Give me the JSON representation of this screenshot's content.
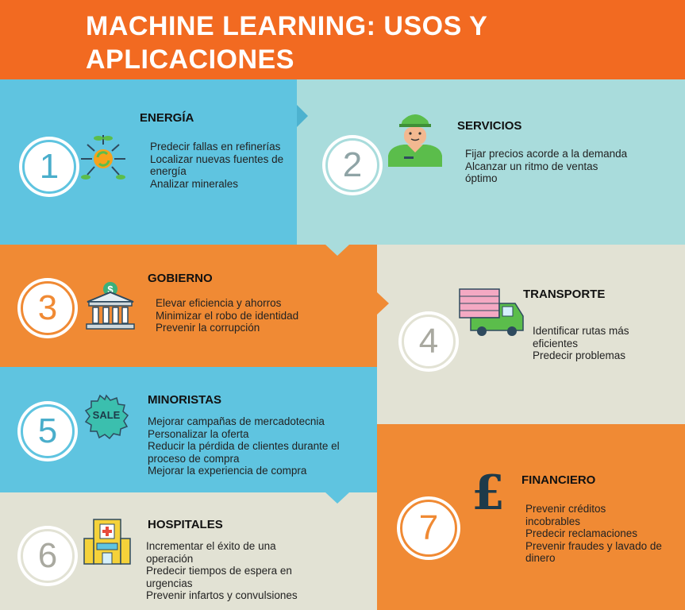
{
  "title": "MACHINE LEARNING: USOS Y APLICACIONES",
  "colors": {
    "orange": "#f26a21",
    "light_orange": "#f08a34",
    "blue": "#5fc4e0",
    "teal": "#a9dcdc",
    "beige": "#e2e2d4"
  },
  "sections": [
    {
      "number": "1",
      "heading": "ENERGÍA",
      "icon": "energy-sprout-icon",
      "items": [
        "Predecir fallas en refinerías",
        "Localizar nuevas fuentes de energía",
        "Analizar minerales"
      ]
    },
    {
      "number": "2",
      "heading": "SERVICIOS",
      "icon": "service-worker-icon",
      "items": [
        "Fijar precios acorde a la demanda",
        "Alcanzar un ritmo de ventas óptimo"
      ]
    },
    {
      "number": "3",
      "heading": "GOBIERNO",
      "icon": "government-building-icon",
      "items": [
        "Elevar eficiencia y ahorros",
        "Minimizar el robo de identidad",
        "Prevenir la corrupción"
      ]
    },
    {
      "number": "4",
      "heading": "TRANSPORTE",
      "icon": "truck-icon",
      "items": [
        "Identificar rutas más eficientes",
        "Predecir problemas"
      ]
    },
    {
      "number": "5",
      "heading": "MINORISTAS",
      "icon": "sale-badge-icon",
      "icon_text": "SALE",
      "items": [
        "Mejorar campañas de mercadotecnia",
        "Personalizar la oferta",
        "Reducir la pérdida de clientes durante el proceso de compra",
        "Mejorar la experiencia de compra"
      ]
    },
    {
      "number": "6",
      "heading": "HOSPITALES",
      "icon": "hospital-icon",
      "items": [
        "Incrementar el éxito de una operación",
        "Predecir tiempos de espera en urgencias",
        "Prevenir infartos y convulsiones"
      ]
    },
    {
      "number": "7",
      "heading": "FINANCIERO",
      "icon": "pound-sign-icon",
      "icon_text": "£",
      "items": [
        "Prevenir créditos incobrables",
        "Predecir reclamaciones",
        "Prevenir fraudes y lavado de dinero"
      ]
    }
  ]
}
